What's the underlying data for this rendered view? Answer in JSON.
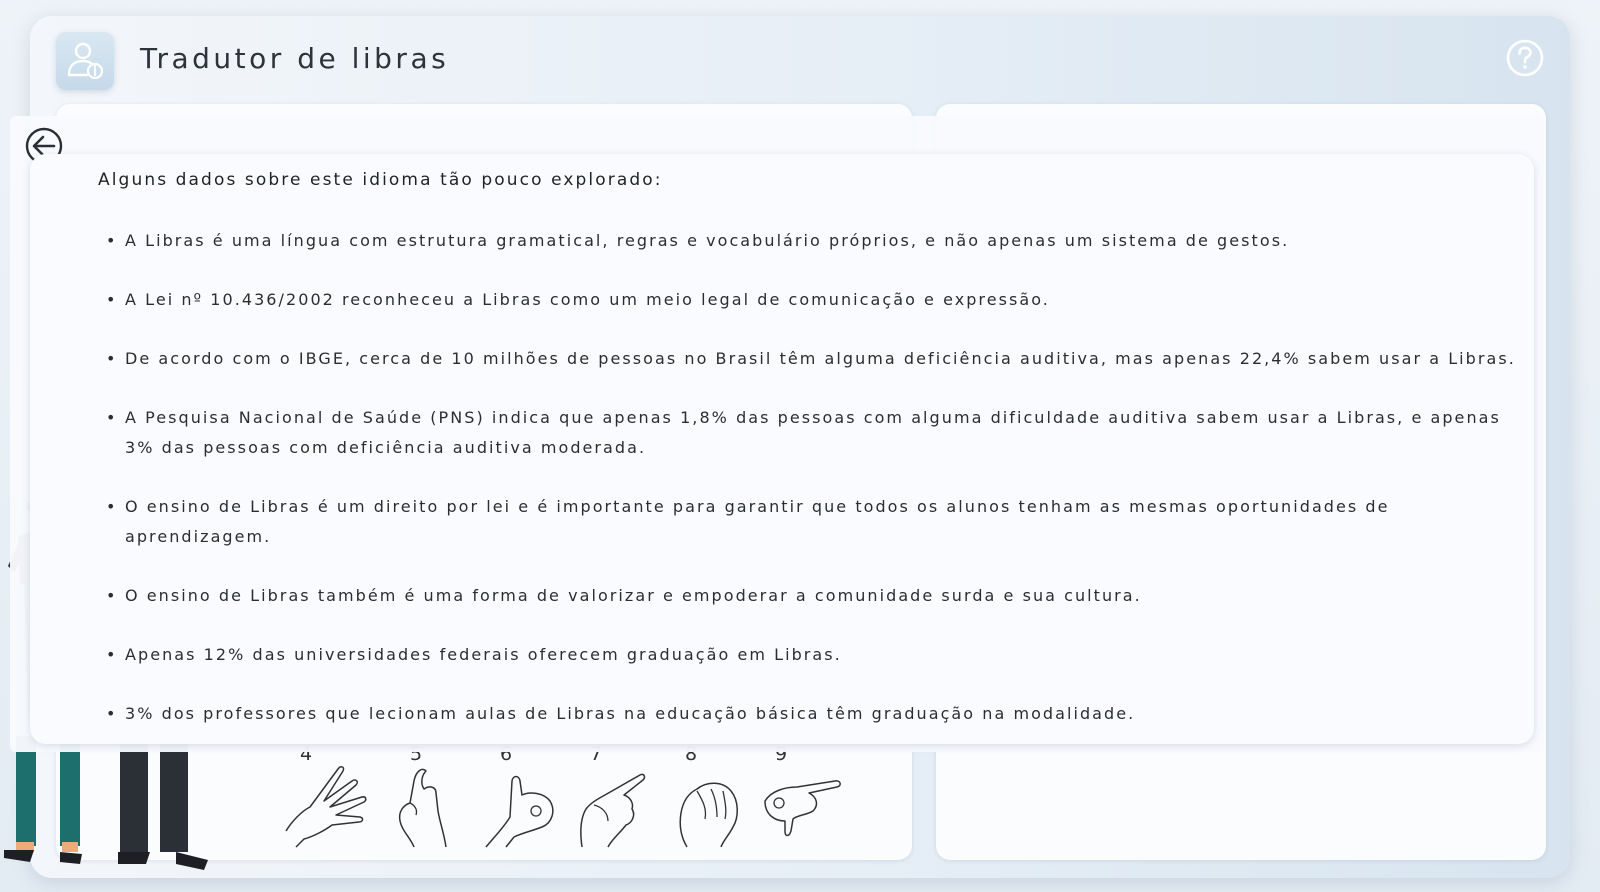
{
  "app": {
    "title": "Tradutor de libras",
    "header_icon": "user-info-icon",
    "help_icon": "question-circle-icon"
  },
  "hand_signs": {
    "numbers": [
      "4",
      "5",
      "6",
      "7",
      "8",
      "9"
    ]
  },
  "modal": {
    "back_icon": "arrow-left-circle-icon",
    "heading": "Alguns dados sobre este idioma tão pouco explorado:",
    "facts": [
      "A Libras é uma língua com estrutura gramatical, regras e vocabulário próprios, e não apenas um sistema de gestos.",
      "A Lei nº 10.436/2002 reconheceu a Libras como um meio legal de comunicação e expressão.",
      "De acordo com o IBGE, cerca de 10 milhões de pessoas no Brasil têm alguma deficiência auditiva, mas apenas 22,4% sabem usar a Libras.",
      "A Pesquisa Nacional de Saúde (PNS) indica que apenas 1,8% das pessoas com alguma dificuldade auditiva sabem usar a Libras, e apenas 3% das pessoas com deficiência auditiva moderada.",
      "O ensino de Libras é um direito por lei e é importante para garantir que todos os alunos tenham as mesmas oportunidades de aprendizagem.",
      "O ensino de Libras também é uma forma de valorizar e empoderar a comunidade surda e sua cultura.",
      "Apenas 12% das universidades federais oferecem graduação em Libras.",
      "3% dos professores que lecionam aulas de Libras na educação básica têm graduação na modalidade."
    ]
  },
  "colors": {
    "background": "#eef3f8",
    "panel": "#fbfcfe",
    "header_icon_bg": "#d2e2ef",
    "text": "#2a2e33",
    "character_shirt": "#263238",
    "character_pants": "#1d6f6e"
  }
}
